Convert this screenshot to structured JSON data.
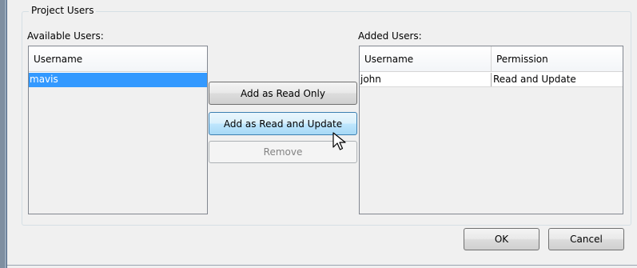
{
  "group": {
    "title": "Project Users"
  },
  "available": {
    "label": "Available Users:",
    "columns": [
      "Username"
    ],
    "rows": [
      "mavis"
    ]
  },
  "added": {
    "label": "Added Users:",
    "columns": [
      "Username",
      "Permission"
    ],
    "rows": [
      {
        "username": "john",
        "permission": "Read and Update"
      }
    ]
  },
  "buttons": {
    "add_read_only": "Add as Read Only",
    "add_read_update": "Add as Read and Update",
    "remove": "Remove",
    "ok": "OK",
    "cancel": "Cancel"
  },
  "colors": {
    "selection": "#3399ff",
    "hover_button": "#bee6fd",
    "disabled_text": "#838383"
  },
  "icons": {
    "cursor": "arrow-cursor-icon"
  }
}
